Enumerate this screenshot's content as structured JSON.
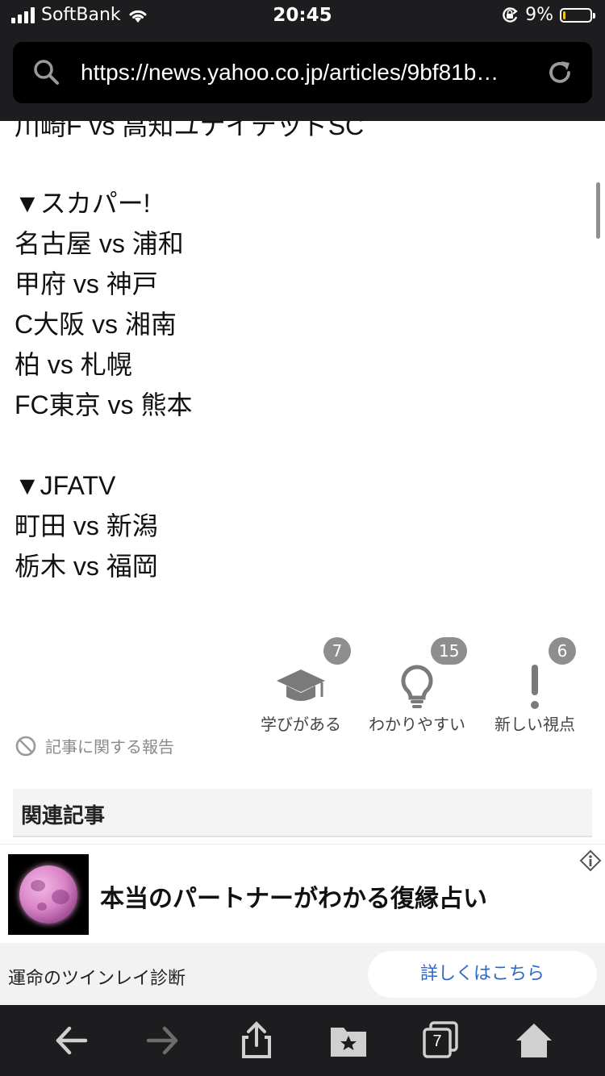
{
  "status_bar": {
    "carrier": "SoftBank",
    "time": "20:45",
    "battery_percent": "9%",
    "battery_level": 0.09
  },
  "browser": {
    "url": "https://news.yahoo.co.jp/articles/9bf81b…"
  },
  "article": {
    "lines": [
      "川崎F vs 高知ユナイテッドSC",
      "▼スカパー!",
      "名古屋 vs 浦和",
      "甲府 vs 神戸",
      "C大阪 vs 湘南",
      "柏 vs 札幌",
      "FC東京 vs 熊本",
      "▼JFATV",
      "町田 vs 新潟",
      "栃木 vs 福岡"
    ]
  },
  "reactions": [
    {
      "label": "学びがある",
      "count": "7",
      "icon": "graduation-cap-icon"
    },
    {
      "label": "わかりやすい",
      "count": "15",
      "icon": "lightbulb-icon"
    },
    {
      "label": "新しい視点",
      "count": "6",
      "icon": "exclamation-icon"
    }
  ],
  "report_label": "記事に関する報告",
  "related_heading": "関連記事",
  "ad": {
    "title": "本当のパートナーがわかる復縁占い",
    "subtitle": "運命のツインレイ診断",
    "cta": "詳しくはこちら",
    "image": "pink-moon-image"
  },
  "toolbar": {
    "tabs_count": "7",
    "icons": [
      "back-arrow-icon",
      "forward-arrow-icon",
      "share-icon",
      "bookmarks-icon",
      "tabs-icon",
      "home-icon"
    ]
  },
  "colors": {
    "chrome": "#1d1d1f",
    "badge": "#8e8e8e",
    "link_blue": "#2f67c9",
    "battery": "#f5c518"
  }
}
